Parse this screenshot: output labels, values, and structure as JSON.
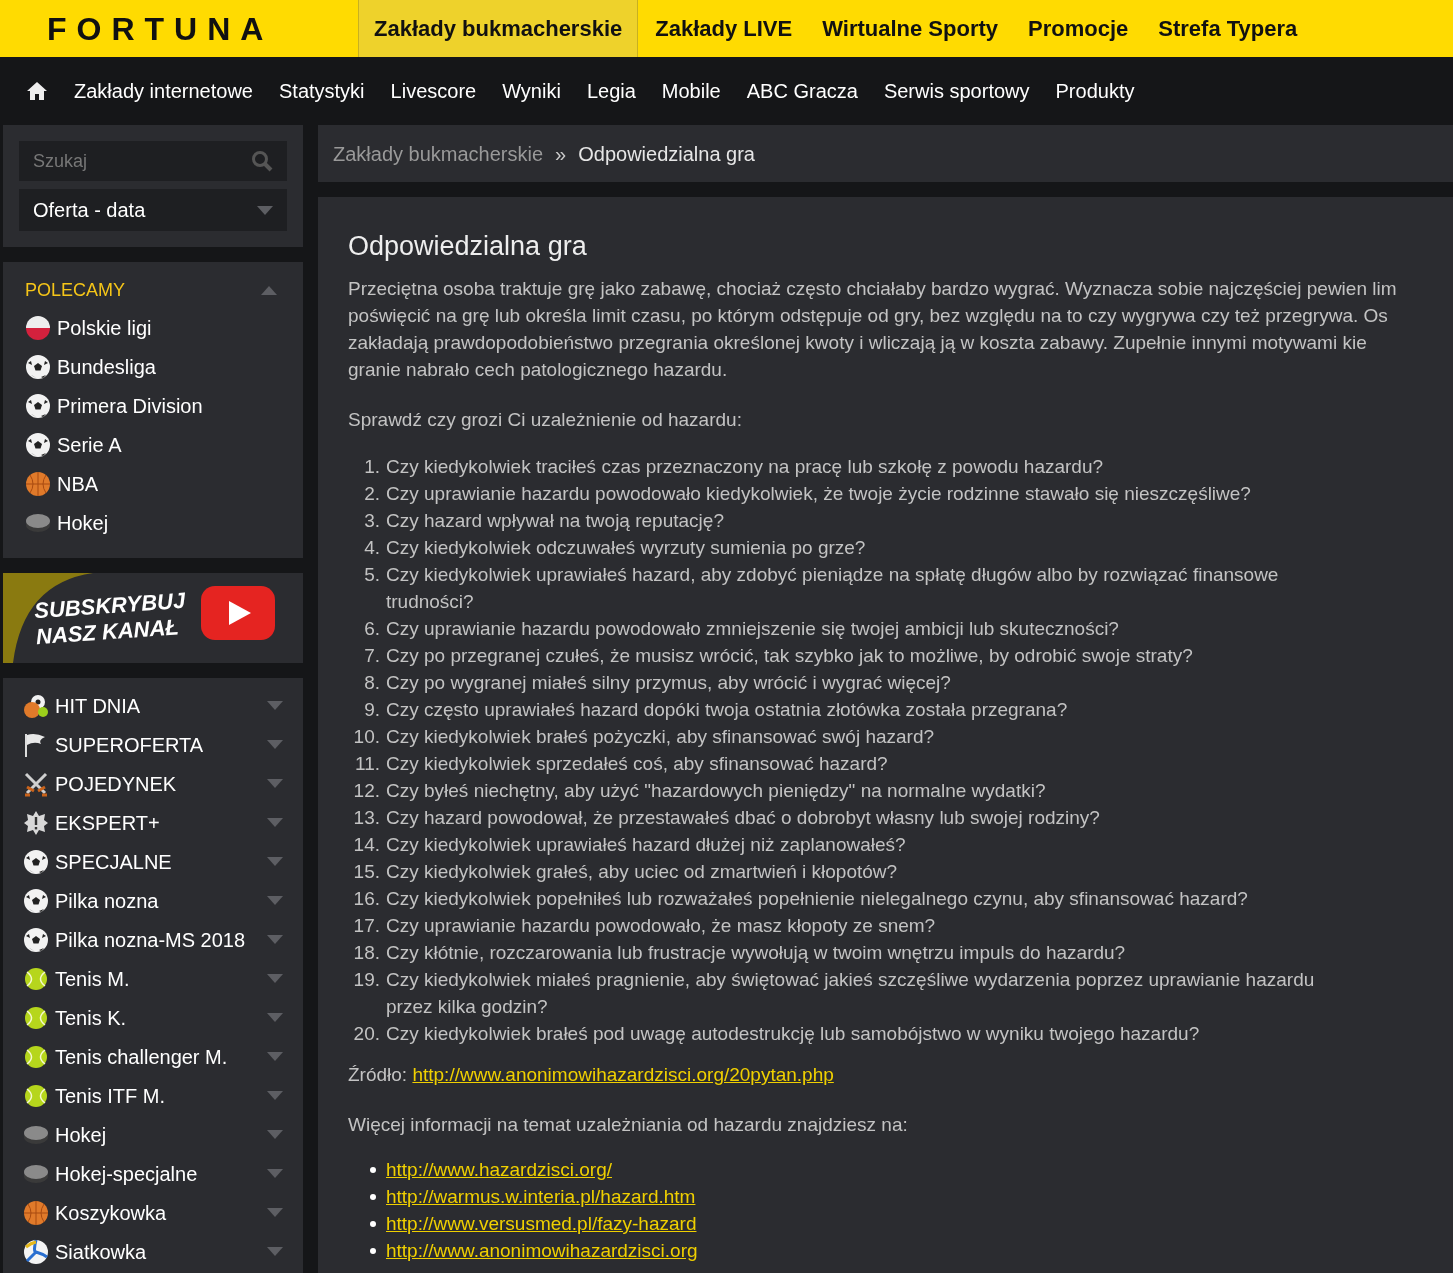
{
  "header": {
    "logo": "FORTUNA",
    "tabs": [
      {
        "label": "Zakłady bukmacherskie",
        "selected": true
      },
      {
        "label": "Zakłady LIVE",
        "selected": false
      },
      {
        "label": "Wirtualne Sporty",
        "selected": false
      },
      {
        "label": "Promocje",
        "selected": false
      },
      {
        "label": "Strefa Typera",
        "selected": false
      }
    ]
  },
  "nav": {
    "items": [
      "Zakłady internetowe",
      "Statystyki",
      "Livescore",
      "Wyniki",
      "Legia",
      "Mobile",
      "ABC Gracza",
      "Serwis sportowy",
      "Produkty"
    ]
  },
  "sidebar": {
    "search": {
      "placeholder": "Szukaj"
    },
    "select": {
      "value": "Oferta - data"
    },
    "featured": {
      "title": "POLECAMY",
      "expanded": true,
      "items": [
        {
          "label": "Polskie ligi",
          "kind": "flag"
        },
        {
          "label": "Bundesliga",
          "kind": "soccer"
        },
        {
          "label": "Primera Division",
          "kind": "soccer"
        },
        {
          "label": "Serie A",
          "kind": "soccer"
        },
        {
          "label": "NBA",
          "kind": "basketball"
        },
        {
          "label": "Hokej",
          "kind": "puck"
        }
      ]
    },
    "banner": {
      "lines": [
        "SUBSKRYBUJ",
        "NASZ KANAŁ"
      ]
    },
    "categories": [
      {
        "label": "HIT DNIA",
        "kind": "mixed",
        "expanded": false
      },
      {
        "label": "SUPEROFERTA",
        "kind": "pennant",
        "expanded": false
      },
      {
        "label": "POJEDYNEK",
        "kind": "swords",
        "expanded": false
      },
      {
        "label": "EKSPERT+",
        "kind": "alert",
        "expanded": false
      },
      {
        "label": "SPECJALNE",
        "kind": "soccer",
        "expanded": false
      },
      {
        "label": "Pilka nozna",
        "kind": "soccer",
        "expanded": false
      },
      {
        "label": "Pilka nozna-MS 2018",
        "kind": "soccer",
        "expanded": false
      },
      {
        "label": "Tenis M.",
        "kind": "tennis",
        "expanded": false
      },
      {
        "label": "Tenis K.",
        "kind": "tennis",
        "expanded": false
      },
      {
        "label": "Tenis challenger M.",
        "kind": "tennis",
        "expanded": false
      },
      {
        "label": "Tenis ITF M.",
        "kind": "tennis",
        "expanded": false
      },
      {
        "label": "Hokej",
        "kind": "puck",
        "expanded": false
      },
      {
        "label": "Hokej-specjalne",
        "kind": "puck",
        "expanded": false
      },
      {
        "label": "Koszykowka",
        "kind": "basketball",
        "expanded": false
      },
      {
        "label": "Siatkowka",
        "kind": "volleyball",
        "expanded": false
      }
    ]
  },
  "breadcrumb": {
    "separator": "»",
    "items": [
      {
        "label": "Zakłady bukmacherskie",
        "current": false
      },
      {
        "label": "Odpowiedzialna gra",
        "current": true
      }
    ]
  },
  "article": {
    "title": "Odpowiedzialna gra",
    "intro_lines": [
      "Przeciętna osoba traktuje grę jako zabawę, chociaż często chciałaby bardzo wygrać. Wyznacza sobie najczęściej pewien lim",
      "poświęcić na grę lub określa limit czasu, po którym odstępuje od gry, bez względu na to czy wygrywa czy też przegrywa. Os",
      "zakładają prawdopodobieństwo przegrania określonej kwoty i wliczają ją w koszta zabawy. Zupełnie innymi motywami kie",
      "granie nabrało cech patologicznego hazardu."
    ],
    "question_intro": "Sprawdź czy grozi Ci uzależnienie od hazardu:",
    "questions": [
      {
        "number": "1.",
        "text": "Czy kiedykolwiek traciłeś czas przeznaczony na pracę lub szkołę z powodu hazardu?"
      },
      {
        "number": "2.",
        "text": "Czy uprawianie hazardu powodowało kiedykolwiek, że twoje życie rodzinne stawało się nieszczęśliwe?"
      },
      {
        "number": "3.",
        "text": "Czy hazard wpływał na twoją reputację?"
      },
      {
        "number": "4.",
        "text": "Czy kiedykolwiek odczuwałeś wyrzuty sumienia po grze?"
      },
      {
        "number": "5.",
        "text": "Czy kiedykolwiek uprawiałeś hazard, aby zdobyć pieniądze na spłatę długów albo by rozwiązać finansowe trudności?"
      },
      {
        "number": "6.",
        "text": "Czy uprawianie hazardu powodowało zmniejszenie się twojej ambicji lub skuteczności?"
      },
      {
        "number": "7.",
        "text": "Czy po przegranej czułeś, że musisz wrócić, tak szybko jak to możliwe, by odrobić swoje straty?"
      },
      {
        "number": "8.",
        "text": "Czy po wygranej miałeś silny przymus, aby wrócić i wygrać więcej?"
      },
      {
        "number": "9.",
        "text": "Czy często uprawiałeś hazard dopóki twoja ostatnia złotówka została przegrana?"
      },
      {
        "number": "10.",
        "text": "Czy kiedykolwiek brałeś pożyczki, aby sfinansować swój hazard?"
      },
      {
        "number": "11.",
        "text": "Czy kiedykolwiek sprzedałeś coś, aby sfinansować hazard?"
      },
      {
        "number": "12.",
        "text": "Czy byłeś niechętny, aby użyć \"hazardowych pieniędzy\" na normalne wydatki?"
      },
      {
        "number": "13.",
        "text": "Czy hazard powodował, że przestawałeś dbać o dobrobyt własny lub swojej rodziny?"
      },
      {
        "number": "14.",
        "text": "Czy kiedykolwiek uprawiałeś hazard dłużej niż zaplanowałeś?"
      },
      {
        "number": "15.",
        "text": "Czy kiedykolwiek grałeś, aby uciec od zmartwień i kłopotów?"
      },
      {
        "number": "16.",
        "text": "Czy kiedykolwiek popełniłeś lub rozważałeś popełnienie nielegalnego czynu, aby sfinansować hazard?"
      },
      {
        "number": "17.",
        "text": "Czy uprawianie hazardu powodowało, że masz kłopoty ze snem?"
      },
      {
        "number": "18.",
        "text": "Czy kłótnie, rozczarowania lub frustracje wywołują w twoim wnętrzu impuls do hazardu?"
      },
      {
        "number": "19.",
        "text": "Czy kiedykolwiek miałeś pragnienie, aby świętować jakieś szczęśliwe wydarzenia poprzez uprawianie hazardu przez kilka godzin?"
      },
      {
        "number": "20.",
        "text": "Czy kiedykolwiek brałeś pod uwagę autodestrukcję lub samobójstwo w wyniku twojego hazardu?"
      }
    ],
    "source": {
      "label": "Źródło:",
      "link": "http://www.anonimowihazardzisci.org/20pytan.php"
    },
    "more": "Więcej informacji na temat uzależniania od hazardu znajdziesz na:",
    "links": [
      "http://www.hazardzisci.org/",
      "http://warmus.w.interia.pl/hazard.htm",
      "http://www.versusmed.pl/fazy-hazard",
      "http://www.anonimowihazardzisci.org"
    ]
  }
}
